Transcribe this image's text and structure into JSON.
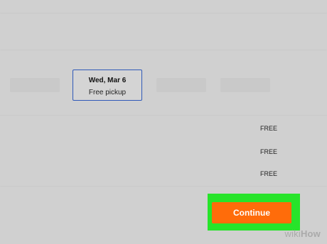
{
  "delivery_options": {
    "selected": {
      "date": "Wed, Mar 6",
      "detail": "Free pickup"
    }
  },
  "shipping_prices": [
    "FREE",
    "FREE",
    "FREE"
  ],
  "continue_button": {
    "label": "Continue",
    "color": "#ff6c0a"
  },
  "highlight": {
    "color": "#27e42a"
  },
  "watermark": {
    "wiki": "wiki",
    "how": "How"
  }
}
